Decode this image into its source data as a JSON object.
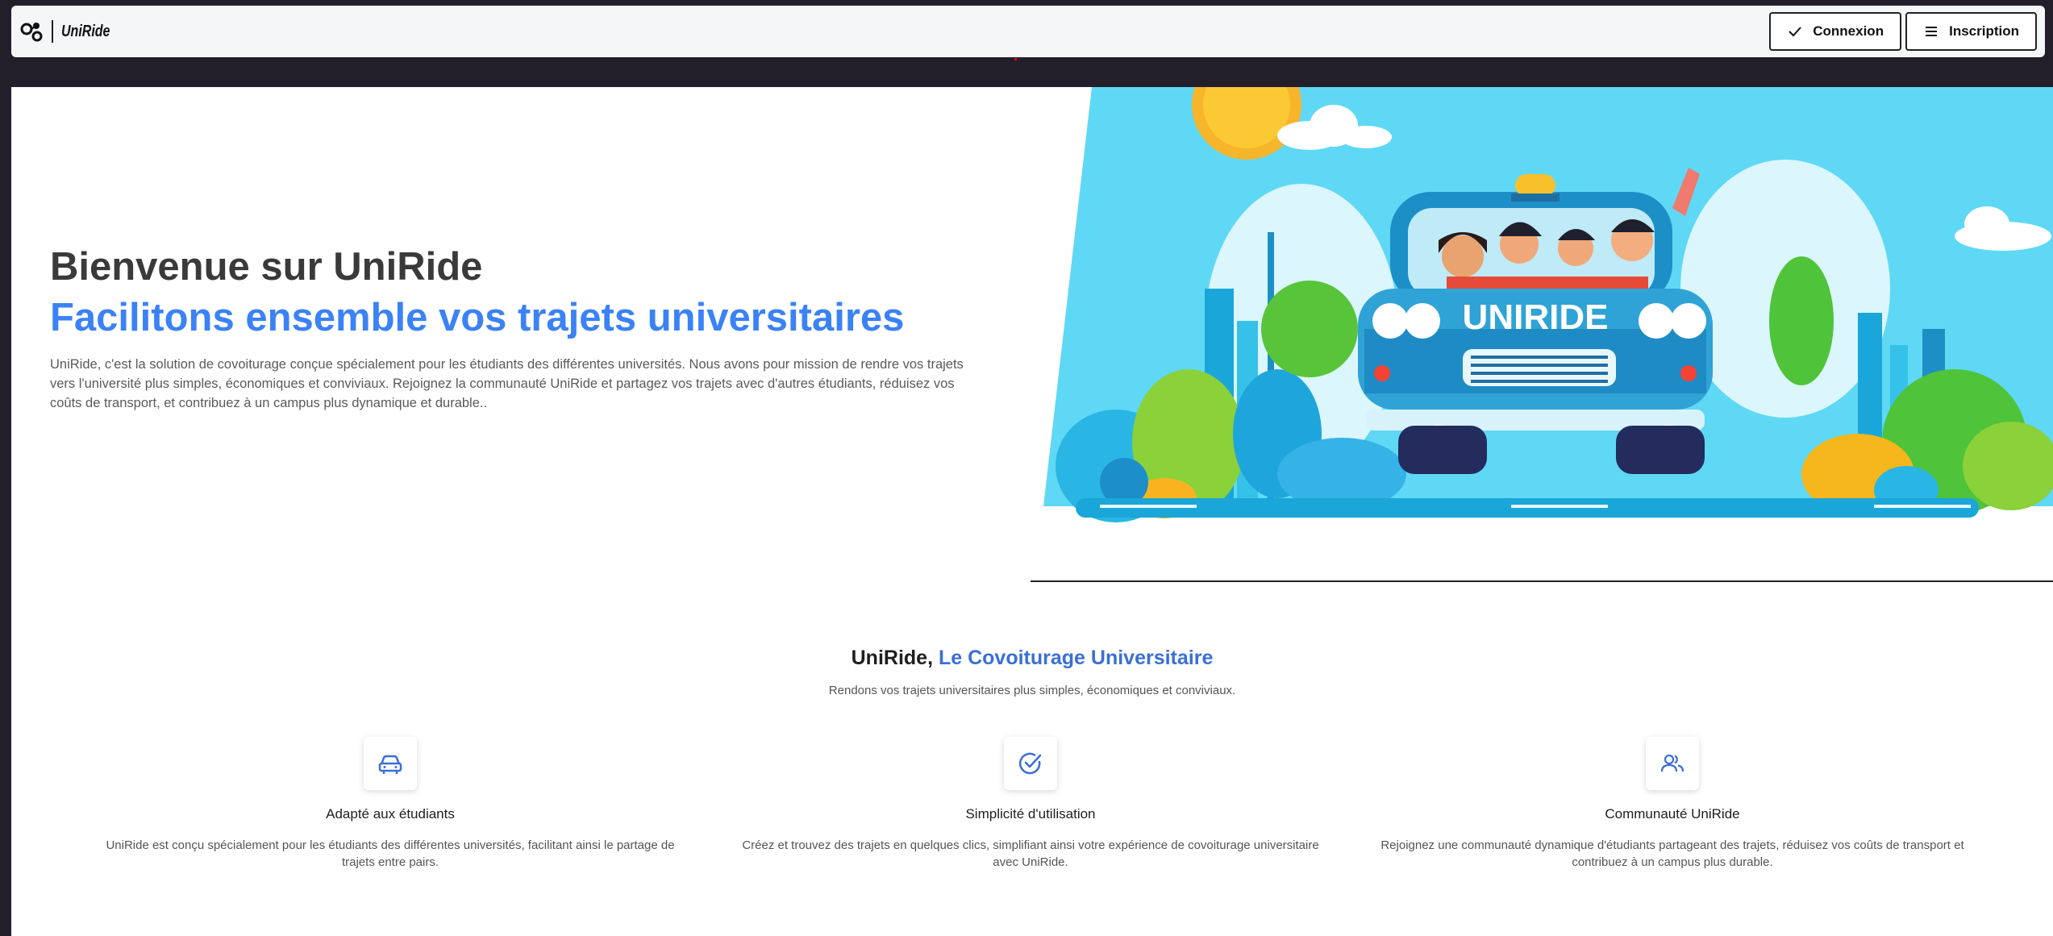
{
  "navbar": {
    "brand": "UniRide",
    "login_label": "Connexion",
    "signup_label": "Inscription"
  },
  "hero": {
    "title": "Bienvenue sur UniRide",
    "subtitle": "Facilitons ensemble vos trajets universitaires",
    "description": "UniRide, c'est la solution de covoiturage conçue spécialement pour les étudiants des différentes universités. Nous avons pour mission de rendre vos trajets vers l'université plus simples, économiques et conviviaux. Rejoignez la communauté UniRide et partagez vos trajets avec d'autres étudiants, réduisez vos coûts de transport, et contribuez à un campus plus dynamique et durable..",
    "car_plate_text": "UNIRIDE"
  },
  "section": {
    "heading_part1": "UniRide,",
    "heading_part2": "Le Covoiturage Universitaire",
    "subheading": "Rendons vos trajets universitaires plus simples, économiques et conviviaux."
  },
  "features": [
    {
      "icon": "car-icon",
      "title": "Adapté aux étudiants",
      "description": "UniRide est conçu spécialement pour les étudiants des différentes universités, facilitant ainsi le partage de trajets entre pairs."
    },
    {
      "icon": "check-circle-icon",
      "title": "Simplicité d'utilisation",
      "description": "Créez et trouvez des trajets en quelques clics, simplifiant ainsi votre expérience de covoiturage universitaire avec UniRide."
    },
    {
      "icon": "users-icon",
      "title": "Communauté UniRide",
      "description": "Rejoignez une communauté dynamique d'étudiants partageant des trajets, réduisez vos coûts de transport et contribuez à un campus plus durable."
    }
  ],
  "colors": {
    "accent": "#3b82f6",
    "sky": "#5fd8f5"
  }
}
